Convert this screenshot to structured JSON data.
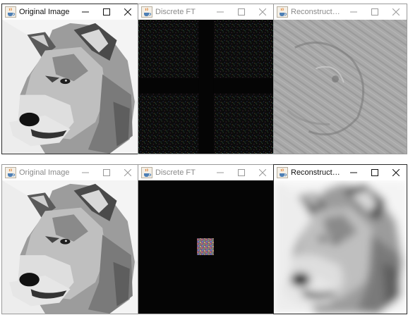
{
  "app_icon": "java-cup-icon",
  "rows": [
    {
      "windows": [
        {
          "name": "original",
          "title": "Original Image",
          "active": true
        },
        {
          "name": "dft",
          "title": "Discrete FT",
          "active": false
        },
        {
          "name": "reconstructed",
          "title": "Reconstructed ...",
          "active": false
        }
      ]
    },
    {
      "windows": [
        {
          "name": "original",
          "title": "Original Image",
          "active": false
        },
        {
          "name": "dft",
          "title": "Discrete FT",
          "active": false
        },
        {
          "name": "reconstructed",
          "title": "Reconstructed ...",
          "active": true
        }
      ]
    }
  ],
  "controls": {
    "minimize_icon": "minimize-icon",
    "maximize_icon": "maximize-icon",
    "close_icon": "close-icon"
  },
  "colors": {
    "dft_background": "#050505",
    "active_title": "#111111",
    "inactive_title": "#8a8a8a"
  }
}
